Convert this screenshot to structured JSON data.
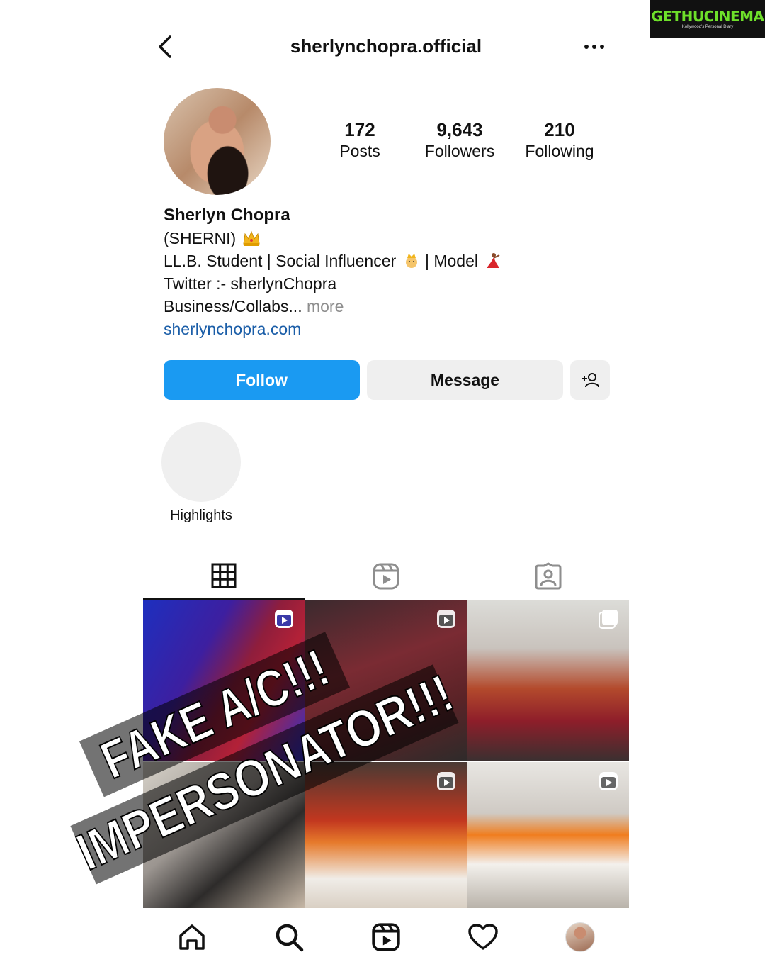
{
  "watermark": {
    "title": "GETHUCINEMA",
    "subtitle": "Kollywood's Personal Diary"
  },
  "header": {
    "username": "sherlynchopra.official"
  },
  "stats": [
    {
      "value": "172",
      "label": "Posts"
    },
    {
      "value": "9,643",
      "label": "Followers"
    },
    {
      "value": "210",
      "label": "Following"
    }
  ],
  "bio": {
    "name": "Sherlyn Chopra",
    "line1": "(SHERNI)",
    "line2a": "LL.B. Student | Social Influencer ",
    "line2b": " | Model",
    "line3": "Twitter :- sherlynChopra",
    "line4": "Business/Collabs...",
    "more": " more",
    "link": "sherlynchopra.com"
  },
  "actions": {
    "follow_label": "Follow",
    "message_label": "Message"
  },
  "highlights": {
    "label": "Highlights"
  },
  "overlay_text": {
    "line1": "FAKE A/C!!!",
    "line2": "IMPERSONATOR!!!"
  },
  "colors": {
    "follow_bg": "#1a9af2",
    "link": "#1b5ea8",
    "secondary_btn": "#efefef"
  },
  "icons": {
    "back": "chevron-left-icon",
    "more": "more-horizontal-icon",
    "add_user": "add-user-icon",
    "grid_tab": "grid-icon",
    "reels_tab": "reels-icon",
    "tagged_tab": "tagged-icon",
    "home": "home-icon",
    "search": "search-icon",
    "reels": "reels-icon",
    "activity": "heart-icon"
  }
}
